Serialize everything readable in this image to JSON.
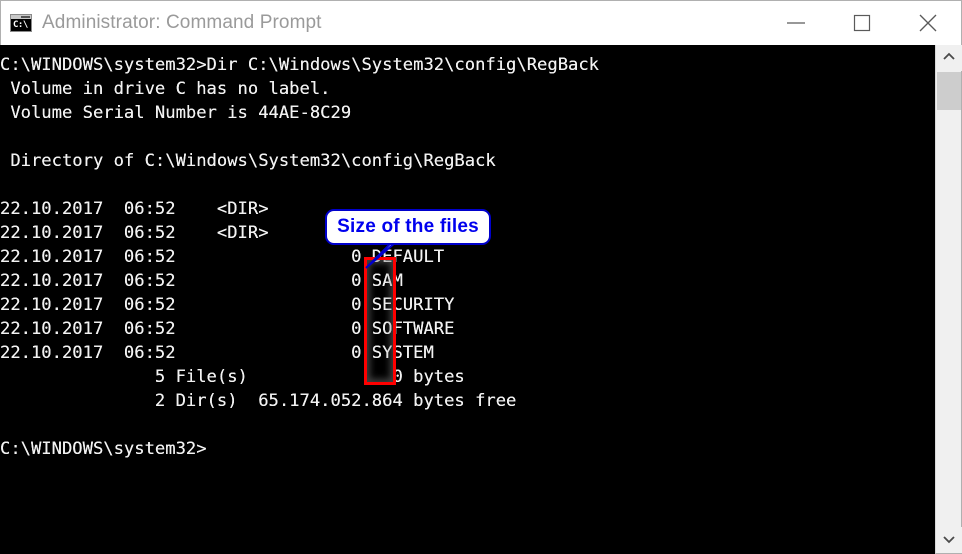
{
  "window": {
    "title": "Administrator: Command Prompt",
    "icon": "command-prompt-icon",
    "icon_glyph": "C:\\",
    "controls": {
      "minimize_label": "Minimize",
      "maximize_label": "Maximize",
      "close_label": "Close"
    }
  },
  "console": {
    "lines": [
      "C:\\WINDOWS\\system32>Dir C:\\Windows\\System32\\config\\RegBack",
      " Volume in drive C has no label.",
      " Volume Serial Number is 44AE-8C29",
      "",
      " Directory of C:\\Windows\\System32\\config\\RegBack",
      "",
      "22.10.2017  06:52    <DIR>          .",
      "22.10.2017  06:52    <DIR>          ..",
      "22.10.2017  06:52                 0 DEFAULT",
      "22.10.2017  06:52                 0 SAM",
      "22.10.2017  06:52                 0 SECURITY",
      "22.10.2017  06:52                 0 SOFTWARE",
      "22.10.2017  06:52                 0 SYSTEM",
      "               5 File(s)              0 bytes",
      "               2 Dir(s)  65.174.052.864 bytes free",
      "",
      "C:\\WINDOWS\\system32>"
    ],
    "command": "Dir C:\\Windows\\System32\\config\\RegBack",
    "prompt": "C:\\WINDOWS\\system32>",
    "volume_label": "no label",
    "volume_serial": "44AE-8C29",
    "directory_path": "C:\\Windows\\System32\\config\\RegBack",
    "entries": [
      {
        "date": "22.10.2017",
        "time": "06:52",
        "type": "<DIR>",
        "size": "",
        "name": "."
      },
      {
        "date": "22.10.2017",
        "time": "06:52",
        "type": "<DIR>",
        "size": "",
        "name": ".."
      },
      {
        "date": "22.10.2017",
        "time": "06:52",
        "type": "",
        "size": "0",
        "name": "DEFAULT"
      },
      {
        "date": "22.10.2017",
        "time": "06:52",
        "type": "",
        "size": "0",
        "name": "SAM"
      },
      {
        "date": "22.10.2017",
        "time": "06:52",
        "type": "",
        "size": "0",
        "name": "SECURITY"
      },
      {
        "date": "22.10.2017",
        "time": "06:52",
        "type": "",
        "size": "0",
        "name": "SOFTWARE"
      },
      {
        "date": "22.10.2017",
        "time": "06:52",
        "type": "",
        "size": "0",
        "name": "SYSTEM"
      }
    ],
    "summary": {
      "file_count": "5",
      "file_bytes": "0",
      "dir_count": "2",
      "free_bytes": "65.174.052.864"
    },
    "text_color": "#f2f2f2",
    "background_color": "#000000"
  },
  "scrollbar": {
    "up_arrow": "chevron-up-icon",
    "down_arrow": "chevron-down-icon",
    "thumb_label": "scrollbar-thumb"
  },
  "annotations": {
    "callout_text": "Size of the files",
    "callout_color": "#0000ee",
    "callout_border_color": "#0000cc",
    "highlight_color": "#ff0000"
  }
}
